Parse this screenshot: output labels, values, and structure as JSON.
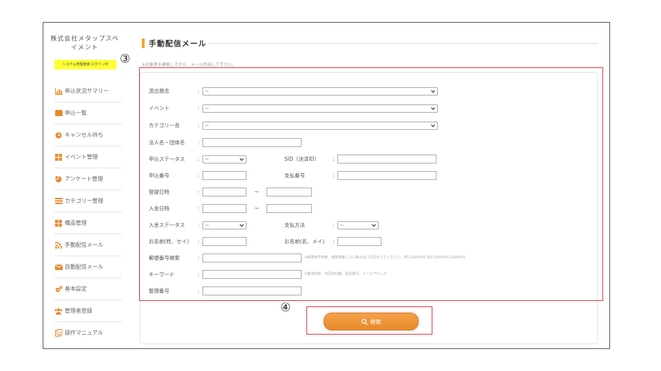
{
  "sidebar": {
    "company_line1": "株式会社メタップスペ",
    "company_line2": "イメント",
    "login_badge": "システム管理者様 ログイン中",
    "items": [
      {
        "label": "申込状況サマリー",
        "icon": "bar-chart-icon"
      },
      {
        "label": "申込一覧",
        "icon": "card-icon"
      },
      {
        "label": "キャンセル待ち",
        "icon": "clock-icon"
      },
      {
        "label": "イベント管理",
        "icon": "grid-icon"
      },
      {
        "label": "アンケート管理",
        "icon": "pie-icon"
      },
      {
        "label": "カテゴリー管理",
        "icon": "list-icon"
      },
      {
        "label": "備品管理",
        "icon": "grid-icon"
      },
      {
        "label": "手動配信メール",
        "icon": "rss-icon"
      },
      {
        "label": "自動配信メール",
        "icon": "mail-icon"
      },
      {
        "label": "基本設定",
        "icon": "gears-icon"
      },
      {
        "label": "管理者登録",
        "icon": "users-icon"
      },
      {
        "label": "操作マニュアル",
        "icon": "manual-icon"
      }
    ]
  },
  "main": {
    "title": "手動配信メール",
    "note": "※対象者を検索してから、メール作成して下さい。",
    "callout_3": "③",
    "callout_4": "④",
    "colon": ":",
    "tilde": "~",
    "form": {
      "inflow": {
        "label": "流出懸念",
        "value": "--"
      },
      "event": {
        "label": "イベント",
        "value": "--"
      },
      "category": {
        "label": "カテゴリー名",
        "value": "--"
      },
      "corp": {
        "label": "法人名・団体名"
      },
      "app_status": {
        "label": "申込ステータス",
        "value": "--"
      },
      "sid": {
        "label": "SID（決済ID）"
      },
      "app_no": {
        "label": "申込番号"
      },
      "pay_no": {
        "label": "支払番号"
      },
      "reg_date": {
        "label": "登録日時"
      },
      "pay_date": {
        "label": "入金日時"
      },
      "pay_status": {
        "label": "入金ステータス",
        "value": "--"
      },
      "pay_method": {
        "label": "支払方法",
        "value": "--"
      },
      "name_kana": {
        "label": "お名前(姓、セイ)"
      },
      "name_first": {
        "label": "お名前(名、メイ)"
      },
      "zip": {
        "label": "郵便番号検索",
        "hint": "※郵便番号検索　複数検索したい場合は[,]で区切ってください。例1:1000000 例2:1000000,1000001"
      },
      "keyword": {
        "label": "キーワード",
        "hint": "※都道府県、市区町村都、電話番号、メールアドレス"
      },
      "ref_no": {
        "label": "整理番号"
      }
    },
    "search_button": "検索"
  }
}
